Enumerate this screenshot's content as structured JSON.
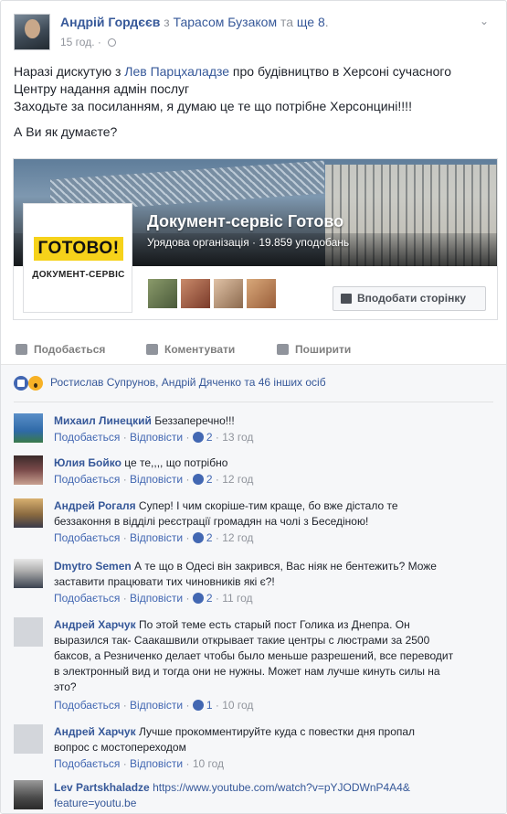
{
  "post": {
    "author": "Андрій Гордєєв",
    "with_word": "з",
    "tagged": "Тарасом Бузаком",
    "and_word": "та",
    "others": "ще 8",
    "period": ".",
    "time": "15 год.",
    "privacy_icon": "globe-icon",
    "menu_icon": "chevron-down-icon",
    "text": {
      "l1_prefix": "Наразі дискутую з ",
      "l1_link": "Лев Парцхаладзе",
      "l1_suffix": " про будівництво в Херсоні сучасного",
      "l2": "Центру надання адмін послуг",
      "l3": "Заходьте за посиланням, я думаю це те що потрібне Херсонцині!!!!",
      "l4": "А Ви як думаєте?"
    }
  },
  "page_card": {
    "logo_main": "ГОТОВО!",
    "logo_sub": "ДОКУМЕНТ-СЕРВІС",
    "name": "Документ-сервіс Готово",
    "category": "Урядова організація",
    "dot": "·",
    "likes": "19.859 уподобань",
    "like_page_button": "Вподобати сторінку",
    "colors": {
      "logo_yellow": "#f6d21a",
      "link_blue": "#365899"
    }
  },
  "actions": {
    "like": "Подобається",
    "comment": "Коментувати",
    "share": "Поширити"
  },
  "reactions": {
    "text": "Ростислав Супрунов, Андрій Дяченко та 46 інших осіб"
  },
  "comment_labels": {
    "like": "Подобається",
    "reply": "Відповісти",
    "dot": "·"
  },
  "comments": [
    {
      "author": "Михаил Линецкий",
      "text": "Беззаперечно!!!",
      "likes": "2",
      "time": "13 год"
    },
    {
      "author": "Юлия Бойко",
      "text": "це те,,,, що потрібно",
      "likes": "2",
      "time": "12 год"
    },
    {
      "author": "Андрей Рогаля",
      "text_l1": "Супер! І чим скоріше-тим краще, бо вже дістало те",
      "text_l2": "беззаконня в відділі реєстрації громадян на чолі з Беседіною!",
      "likes": "2",
      "time": "12 год"
    },
    {
      "author": "Dmytro Semen",
      "text_l1": "А те що в Одесі він закрився, Вас ніяк не бентежить? Може",
      "text_l2": "заставити працювати тих чиновників які є?!",
      "likes": "2",
      "time": "11 год"
    },
    {
      "author": "Андрей Харчук",
      "text_l1": "По этой теме есть старый пост Голика из Днепра. Он",
      "text_l2": "выразился так- Саакашвили открывает такие центры с люстрами за 2500",
      "text_l3": "баксов, а Резниченко делает чтобы было меньше разрешений, все переводит",
      "text_l4": "в электронный вид и тогда они не нужны. Может нам лучше кинуть силы на",
      "text_l5": "это?",
      "likes": "1",
      "time": "10 год"
    },
    {
      "author": "Андрей Харчук",
      "text_l1": "Лучше прокомментируйте куда с повестки дня пропал",
      "text_l2": "вопрос с мостопереходом",
      "time": "10 год"
    },
    {
      "author": "Lev Partskhaladze",
      "link_l1": "https://www.youtube.com/watch?v=pYJODWnP4A4&",
      "link_l2": "feature=youtu.be"
    }
  ]
}
